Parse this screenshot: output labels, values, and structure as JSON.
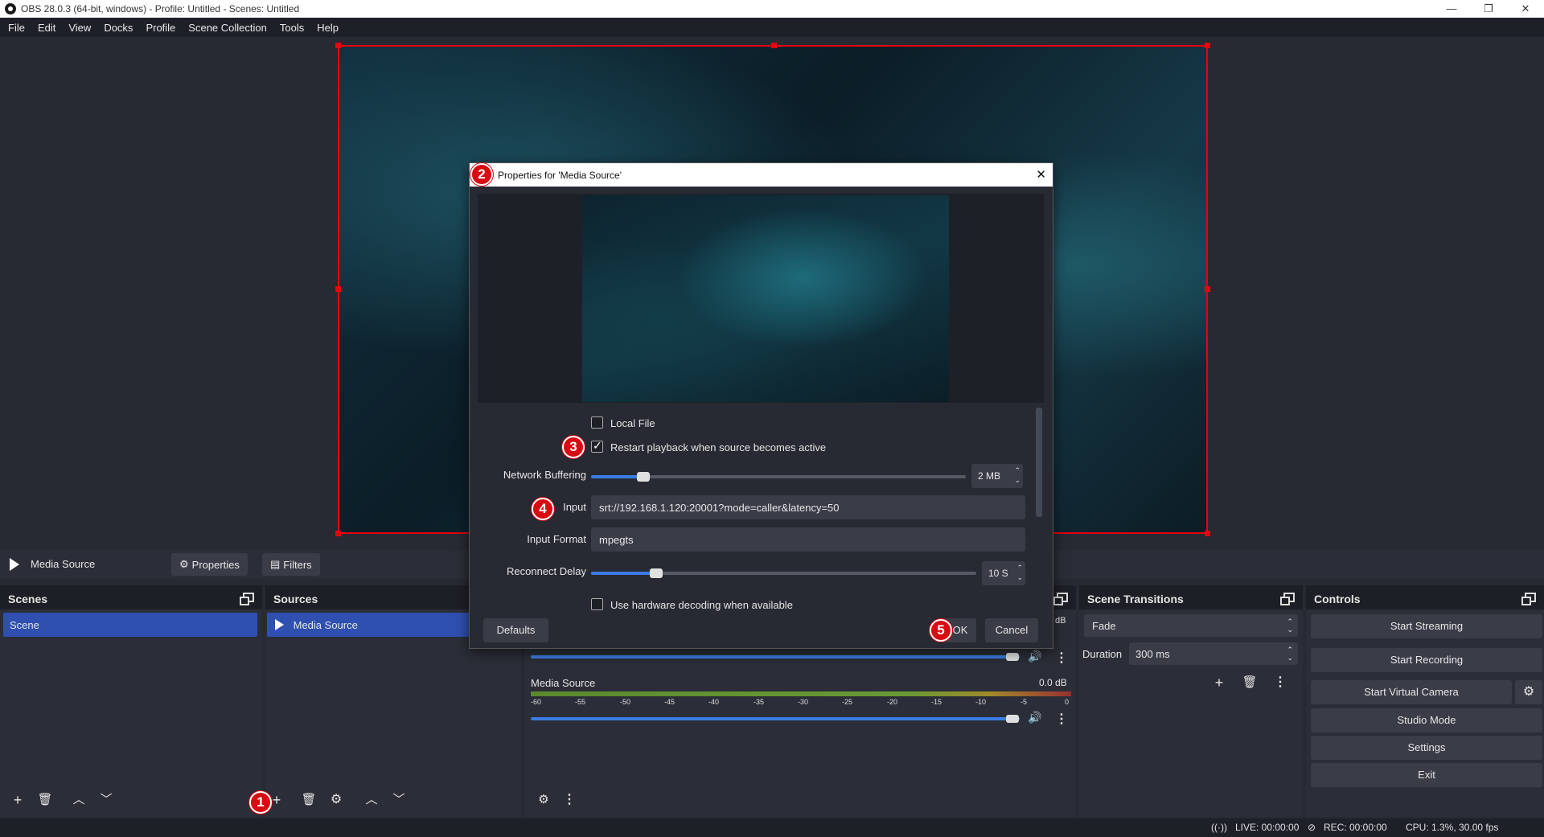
{
  "window": {
    "title": "OBS 28.0.3 (64-bit, windows) - Profile: Untitled - Scenes: Untitled",
    "minimize": "—",
    "maximize": "❐",
    "close": "✕"
  },
  "menu": [
    "File",
    "Edit",
    "View",
    "Docks",
    "Profile",
    "Scene Collection",
    "Tools",
    "Help"
  ],
  "source_bar": {
    "source_name": "Media Source",
    "properties_label": "Properties",
    "filters_label": "Filters"
  },
  "scenes": {
    "title": "Scenes",
    "items": [
      "Scene"
    ]
  },
  "sources": {
    "title": "Sources",
    "items": [
      "Media Source"
    ]
  },
  "mixer": {
    "top_db": "dB",
    "channel_name": "Media Source",
    "channel_db": "0.0 dB",
    "ticks": [
      "-60",
      "-55",
      "-50",
      "-45",
      "-40",
      "-35",
      "-30",
      "-25",
      "-20",
      "-15",
      "-10",
      "-5",
      "0"
    ],
    "volume": 0.97
  },
  "transitions": {
    "title": "Scene Transitions",
    "selected": "Fade",
    "duration_label": "Duration",
    "duration_value": "300 ms"
  },
  "controls": {
    "title": "Controls",
    "start_streaming": "Start Streaming",
    "start_recording": "Start Recording",
    "start_virtual_camera": "Start Virtual Camera",
    "studio_mode": "Studio Mode",
    "settings": "Settings",
    "exit": "Exit"
  },
  "status": {
    "live": "LIVE: 00:00:00",
    "rec": "REC: 00:00:00",
    "cpu": "CPU: 1.3%, 30.00 fps"
  },
  "dialog": {
    "title": "Properties for 'Media Source'",
    "close": "✕",
    "local_file_label": "Local File",
    "local_file_checked": false,
    "restart_label": "Restart playback when source becomes active",
    "restart_checked": true,
    "network_buffering_label": "Network Buffering",
    "network_buffering_value": "2 MB",
    "network_buffering_level": 0.14,
    "input_label": "Input",
    "input_value": "srt://192.168.1.120:20001?mode=caller&latency=50",
    "input_format_label": "Input Format",
    "input_format_value": "mpegts",
    "reconnect_label": "Reconnect Delay",
    "reconnect_value": "10 S",
    "reconnect_level": 0.17,
    "hw_decode_label": "Use hardware decoding when available",
    "hw_decode_checked": false,
    "defaults": "Defaults",
    "ok": "OK",
    "cancel": "Cancel"
  },
  "badges": [
    "1",
    "2",
    "3",
    "4",
    "5"
  ],
  "colors": {
    "selection_red": "#e8000f",
    "selected_item": "#2f50b0",
    "slider_blue": "#3a7de4",
    "badge_red": "#d80a12"
  }
}
